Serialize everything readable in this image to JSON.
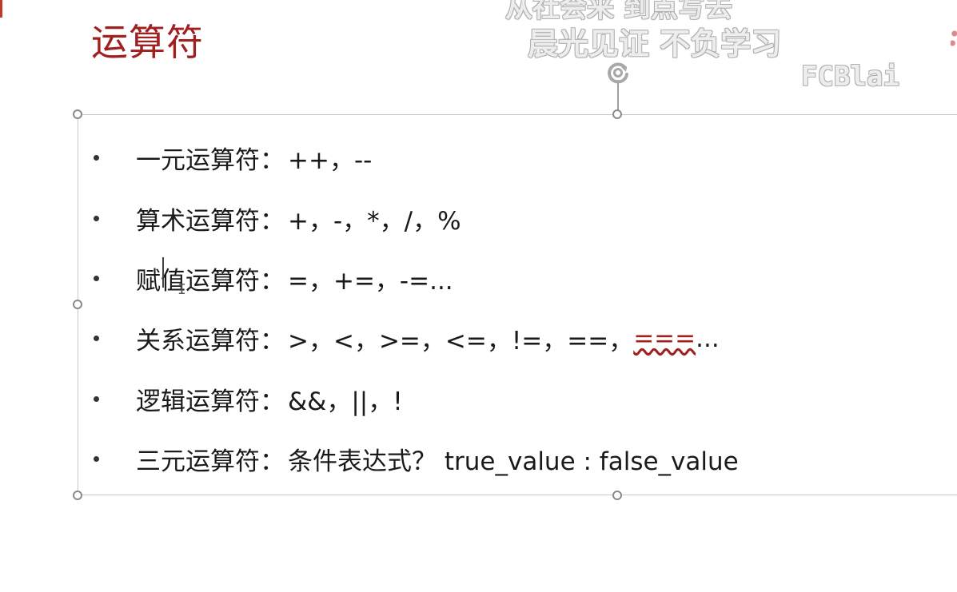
{
  "slide": {
    "title": "运算符",
    "accent_color": "#a11f1f"
  },
  "watermark": {
    "line1": "从社会来 到点写去",
    "line2": "晨光见证 不负学习",
    "brand": "FCBlai"
  },
  "icons": {
    "rotate": "rotate-handle-icon"
  },
  "bullets": [
    {
      "label": "一元运算符：",
      "ops": "++，--",
      "ops_hl": "",
      "ops_tail": ""
    },
    {
      "label": "算术运算符：",
      "ops": "+，-，*，/，%",
      "ops_hl": "",
      "ops_tail": ""
    },
    {
      "label": "赋值运算符：",
      "ops": "=，+=，-=...",
      "ops_hl": "",
      "ops_tail": ""
    },
    {
      "label": "关系运算符：",
      "ops": ">，<，>=，<=，!=，==，",
      "ops_hl": "===",
      "ops_tail": "..."
    },
    {
      "label": "逻辑运算符：",
      "ops": "&&，||，!",
      "ops_hl": "",
      "ops_tail": ""
    },
    {
      "label": "三元运算符：",
      "ops": "条件表达式？ true_value : false_value",
      "ops_hl": "",
      "ops_tail": ""
    }
  ]
}
